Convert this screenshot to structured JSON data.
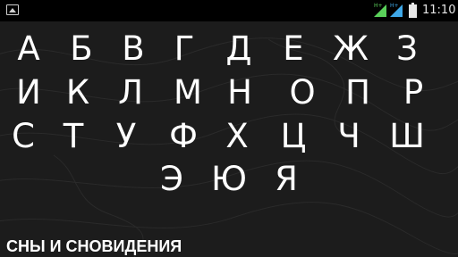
{
  "statusbar": {
    "time": "11:10",
    "network_labels": [
      "H+",
      "H+"
    ],
    "icons": [
      "image-notification-icon",
      "signal-icon",
      "signal-icon",
      "battery-icon"
    ]
  },
  "alphabet": {
    "rows": [
      [
        "А",
        "Б",
        "В",
        "Г",
        "Д",
        "Е",
        "Ж",
        "З"
      ],
      [
        "И",
        "К",
        "Л",
        "М",
        "Н",
        "О",
        "П",
        "Р"
      ],
      [
        "С",
        "Т",
        "У",
        "Ф",
        "Х",
        "Ц",
        "Ч",
        "Ш"
      ],
      [
        "Э",
        "Ю",
        "Я"
      ]
    ]
  },
  "footer": {
    "title": "СНЫ И СНОВИДЕНИЯ"
  },
  "colors": {
    "background": "#1c1c1c",
    "statusbar": "#000000",
    "text": "#ffffff",
    "signal_green": "#5ad05a",
    "signal_blue": "#3fa8e8"
  }
}
